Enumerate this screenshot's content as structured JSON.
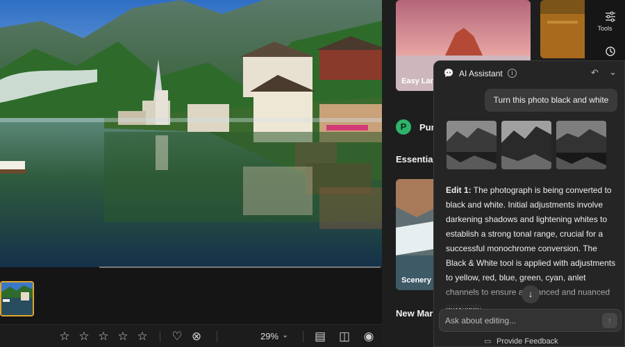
{
  "rating": {
    "stars": [
      "star-1",
      "star-2",
      "star-3",
      "star-4",
      "star-5"
    ],
    "value": 0
  },
  "toolbar": {
    "zoom": "29%"
  },
  "browse": {
    "cards": [
      {
        "label": "Easy Land"
      },
      {
        "label": ""
      },
      {
        "label": "Scenery"
      }
    ],
    "sections": {
      "pur": "Pur",
      "essentials": "Essentials",
      "new_mar": "New Mar"
    }
  },
  "tools": {
    "label": "Tools"
  },
  "ai": {
    "title": "AI Assistant",
    "user_message": "Turn this photo black and white",
    "edit_label": "Edit 1:",
    "response": " The photograph is being converted to black and white. Initial adjustments involve darkening shadows and lightening whites to establish a strong tonal range, crucial for a successful monochrome conversion. The Black & White tool is applied with adjustments to yellow, red, blue, green, cyan, an",
    "response_tail": "let channels to ensure a balanced and nuanced grayscale",
    "input_placeholder": "Ask about editing...",
    "feedback": "Provide Feedback"
  },
  "colors": {
    "accent": "#e0a52a",
    "panel": "#252526",
    "pur_green": "#2fb36b"
  }
}
